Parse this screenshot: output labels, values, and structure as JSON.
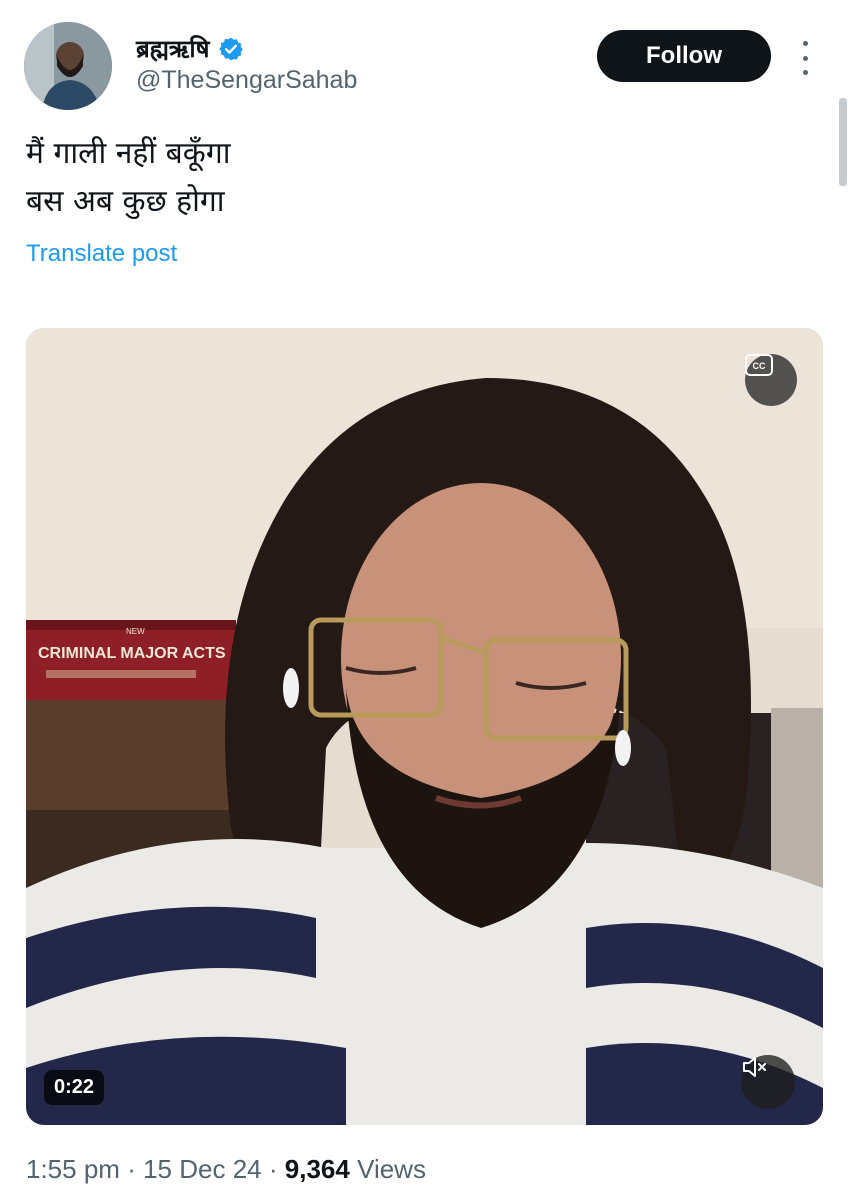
{
  "author": {
    "display_name": "ब्रह्मऋषि",
    "handle": "@TheSengarSahab",
    "verified": true
  },
  "follow_label": "Follow",
  "post": {
    "lines": [
      "मैं गाली नहीं बकूँगा",
      "बस अब कुछ होगा"
    ],
    "translate_label": "Translate post"
  },
  "video": {
    "duration": "0:22",
    "cc_icon": "cc-icon",
    "mute_icon": "muted-speaker-icon",
    "book_title": "CRIMINAL MAJOR ACTS",
    "book_label_new": "NEW"
  },
  "meta": {
    "time": "1:55 pm",
    "separator": "·",
    "date": "15 Dec 24",
    "views_count": "9,364",
    "views_label": "Views"
  },
  "colors": {
    "link": "#1d9bf0",
    "secondary_text": "#536471",
    "follow_bg": "#0f1419",
    "verified": "#1d9bf0"
  }
}
